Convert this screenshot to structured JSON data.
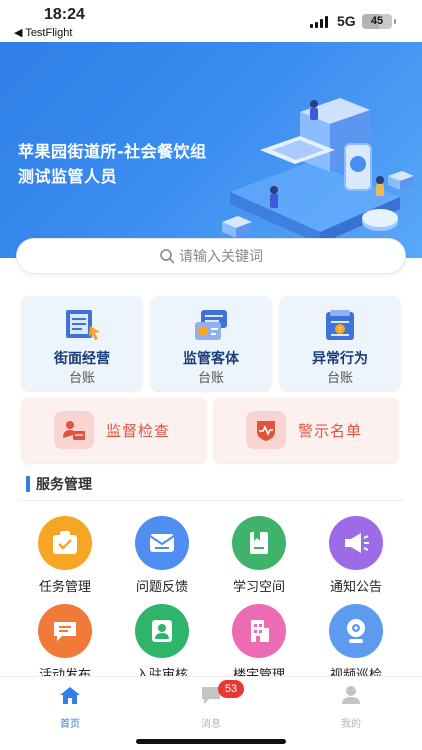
{
  "status_bar": {
    "time": "18:24",
    "back_app": "◀ TestFlight",
    "network": "5G",
    "battery": "45"
  },
  "hero": {
    "title": "苹果园街道所-社会餐饮组",
    "subtitle": "测试监管人员"
  },
  "search": {
    "placeholder": "请输入关键词",
    "icon": "search-icon"
  },
  "ledgers": [
    {
      "line1": "街面经营",
      "line2": "台账",
      "icon": "street-business-icon"
    },
    {
      "line1": "监管客体",
      "line2": "台账",
      "icon": "supervised-entity-icon"
    },
    {
      "line1": "异常行为",
      "line2": "台账",
      "icon": "abnormal-behavior-icon"
    }
  ],
  "alerts": [
    {
      "label": "监督检查",
      "icon": "inspection-icon"
    },
    {
      "label": "警示名单",
      "icon": "warning-list-icon"
    }
  ],
  "section": {
    "title": "服务管理"
  },
  "services": [
    {
      "label": "任务管理",
      "color": "#f6a623",
      "icon": "task-icon"
    },
    {
      "label": "问题反馈",
      "color": "#4f8ef0",
      "icon": "feedback-icon"
    },
    {
      "label": "学习空间",
      "color": "#3fb36b",
      "icon": "book-icon"
    },
    {
      "label": "通知公告",
      "color": "#9b6be8",
      "icon": "megaphone-icon"
    },
    {
      "label": "活动发布",
      "color": "#f07a3a",
      "icon": "activity-icon"
    },
    {
      "label": "入驻审核",
      "color": "#2fb56a",
      "icon": "review-icon"
    },
    {
      "label": "楼宇管理",
      "color": "#ec6bb3",
      "icon": "building-icon"
    },
    {
      "label": "视频巡检",
      "color": "#5d9bf0",
      "icon": "camera-icon"
    }
  ],
  "tabbar": {
    "tabs": [
      {
        "label": "首页",
        "icon": "home-icon",
        "active": true
      },
      {
        "label": "消息",
        "icon": "message-icon",
        "active": false
      },
      {
        "label": "我的",
        "icon": "profile-icon",
        "active": false
      }
    ],
    "message_badge": "53"
  },
  "colors": {
    "primary": "#2f7fe6",
    "alert_text": "#e0533f",
    "active_tab": "#2f7fe6",
    "inactive_tab": "#b5b5b5"
  }
}
